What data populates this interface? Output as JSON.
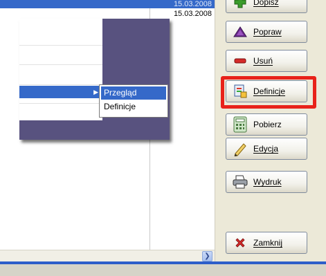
{
  "list": {
    "dates": [
      "15.03.2008",
      "15.03.2008"
    ]
  },
  "menu": {
    "submenu_items": [
      "Przegląd",
      "Definicje"
    ]
  },
  "buttons": [
    {
      "label": "Dopisz",
      "icon": "plus-icon"
    },
    {
      "label": "Popraw",
      "icon": "triangle-icon"
    },
    {
      "label": "Usuń",
      "icon": "eraser-icon"
    },
    {
      "label": "Definicje",
      "icon": "definitions-icon"
    },
    {
      "label": "Pobierz",
      "icon": "calculator-icon"
    },
    {
      "label": "Edycja",
      "icon": "pencil-icon"
    },
    {
      "label": "Wydruk",
      "icon": "printer-icon"
    },
    {
      "label": "Zamknij",
      "icon": "close-x-icon"
    }
  ],
  "highlight": {
    "color": "#e8221a",
    "target": "Definicje"
  },
  "colors": {
    "selection": "#3569c9",
    "menu_panel": "#58527f",
    "button_face": "#ece9d8"
  }
}
